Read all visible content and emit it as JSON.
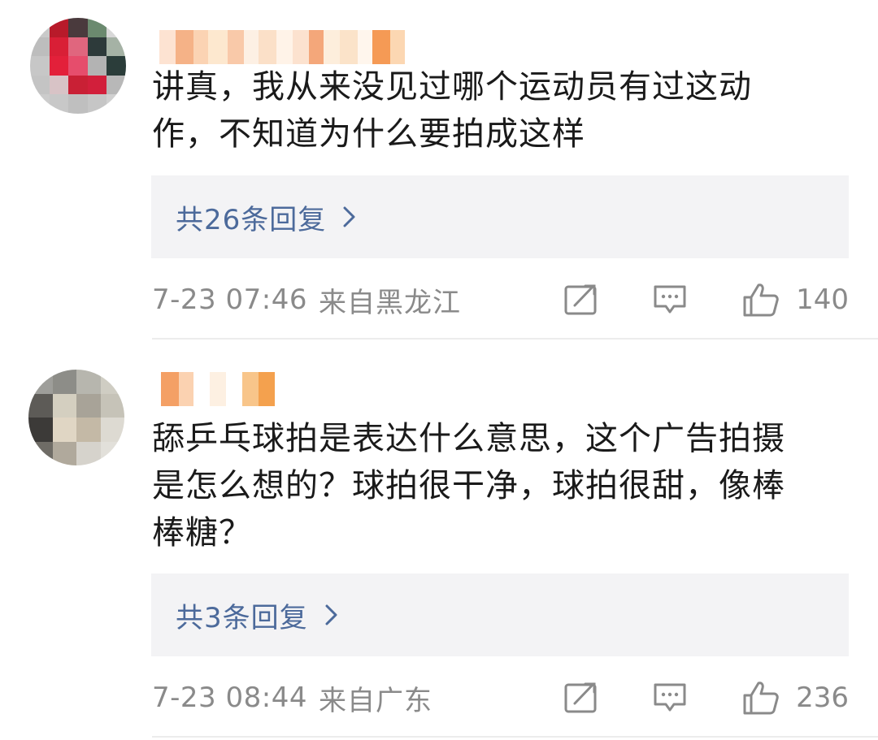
{
  "comments": [
    {
      "text_lines": [
        "讲真，我从来没见过哪个运动员有过这动",
        "作，不知道为什么要拍成这样"
      ],
      "replies_label": "共26条回复",
      "time": "7-23 07:46",
      "location": "来自黑龙江",
      "likes": "140"
    },
    {
      "text_lines": [
        "舔乒乓球拍是表达什么意思，这个广告拍摄",
        "是怎么想的？球拍很干净，球拍很甜，像棒",
        "棒糖？"
      ],
      "replies_label": "共3条回复",
      "time": "7-23 08:44",
      "location": "来自广东",
      "likes": "236"
    }
  ],
  "icons": {
    "forward": "share-edit-icon",
    "comment": "comment-icon",
    "like": "thumbs-up-icon",
    "replies_chevron": "chevron-right-icon"
  },
  "colors": {
    "reply_link": "#4c6a9b",
    "meta_text": "#8a8a8a",
    "reply_bg": "#f3f3f5"
  }
}
